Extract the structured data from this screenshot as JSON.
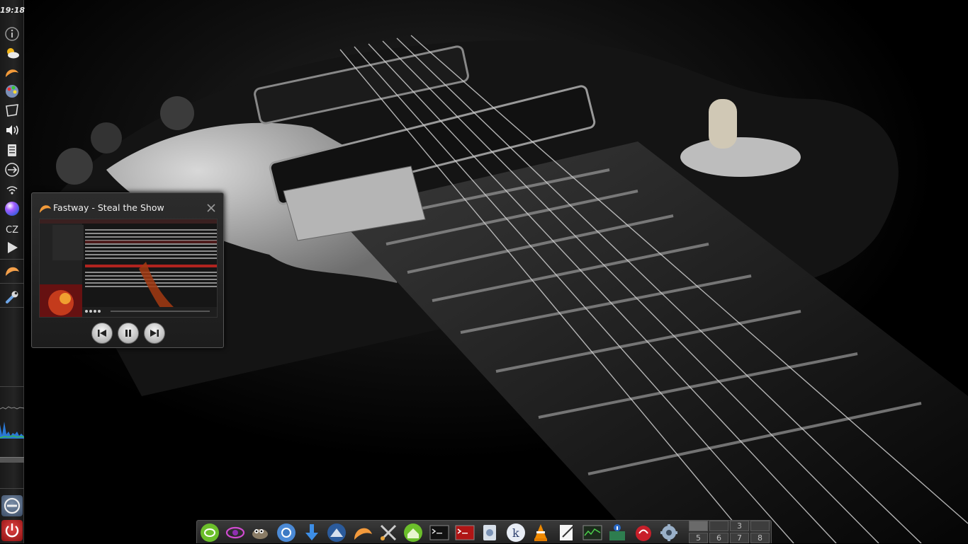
{
  "panel": {
    "clock": "19:18",
    "keyboard_layout": "CZ",
    "tray_icons": [
      "info-icon",
      "weather-icon",
      "clementine-icon",
      "color-picker-icon",
      "notes-icon",
      "volume-icon",
      "clipboard-icon",
      "usb-icon",
      "wifi-icon",
      "color-orb-icon",
      "play-icon",
      "clementine-icon",
      "wrench-icon"
    ]
  },
  "player": {
    "title": "Fastway - Steal the Show",
    "controls": [
      "previous-icon",
      "pause-icon",
      "next-icon"
    ]
  },
  "dock": {
    "icons": [
      "opensuse-icon",
      "eye-icon",
      "gimp-icon",
      "chromium-icon",
      "download-icon",
      "thunderbird-icon",
      "clementine-icon",
      "tools-icon",
      "home-icon",
      "terminal-icon",
      "root-terminal-icon",
      "disk-icon",
      "kget-icon",
      "vlc-icon",
      "text-editor-icon",
      "system-monitor-icon",
      "network-icon",
      "bug-icon",
      "settings-icon"
    ]
  },
  "pager": {
    "workspaces": [
      "",
      "",
      "3",
      "",
      "5",
      "6",
      "7",
      "8"
    ]
  }
}
